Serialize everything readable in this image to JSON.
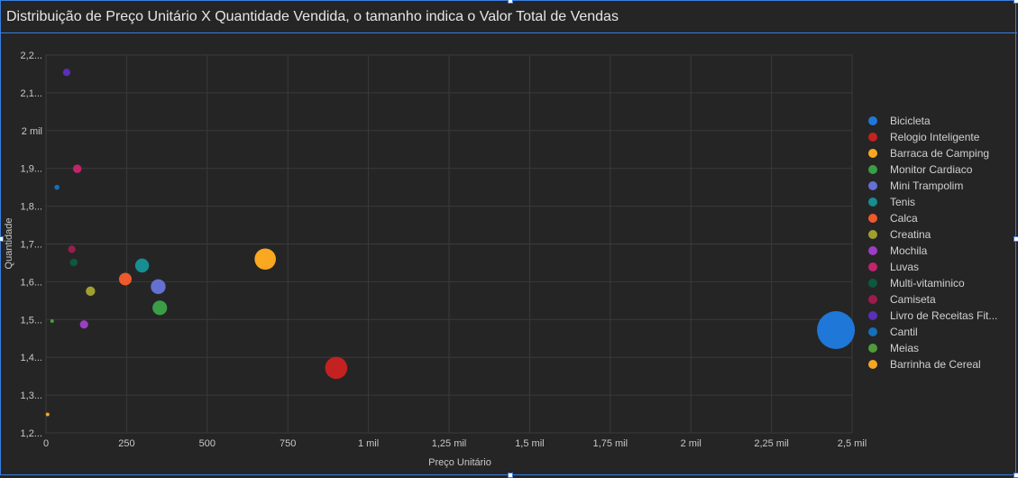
{
  "title": "Distribuição de Preço Unitário X Quantidade Vendida, o tamanho indica o Valor Total de Vendas",
  "chart_data": {
    "type": "scatter",
    "title": "Distribuição de Preço Unitário X Quantidade Vendida, o tamanho indica o Valor Total de Vendas",
    "xlabel": "Preço Unitário",
    "ylabel": "Quantidade",
    "xlim": [
      0,
      2500
    ],
    "ylim": [
      1200,
      2200
    ],
    "x_ticks": [
      0,
      250,
      500,
      750,
      1000,
      1250,
      1500,
      1750,
      2000,
      2250,
      2500
    ],
    "x_tick_labels": [
      "0",
      "250",
      "500",
      "750",
      "1 mil",
      "1,25 mil",
      "1,5 mil",
      "1,75 mil",
      "2 mil",
      "2,25 mil",
      "2,5 mil"
    ],
    "y_ticks": [
      1200,
      1300,
      1400,
      1500,
      1600,
      1700,
      1800,
      1900,
      2000,
      2100,
      2200
    ],
    "y_tick_labels": [
      "1,2...",
      "1,3...",
      "1,4...",
      "1,5...",
      "1,6...",
      "1,7...",
      "1,8...",
      "1,9...",
      "2 mil",
      "2,1...",
      "2,2..."
    ],
    "grid": true,
    "legend_position": "right",
    "series": [
      {
        "name": "Bicicleta",
        "x": 2450,
        "y": 1472,
        "size": 3606,
        "color": "#1f78d8"
      },
      {
        "name": "Relogio Inteligente",
        "x": 900,
        "y": 1372,
        "size": 1235,
        "color": "#c42121"
      },
      {
        "name": "Barraca de Camping",
        "x": 680,
        "y": 1660,
        "size": 1129,
        "color": "#f9a81f"
      },
      {
        "name": "Monitor Cardiaco",
        "x": 353,
        "y": 1531,
        "size": 540,
        "color": "#3a9e47"
      },
      {
        "name": "Mini Trampolim",
        "x": 348,
        "y": 1587,
        "size": 552,
        "color": "#6470d2"
      },
      {
        "name": "Tenis",
        "x": 298,
        "y": 1643,
        "size": 490,
        "color": "#168e92"
      },
      {
        "name": "Calca",
        "x": 246,
        "y": 1607,
        "size": 395,
        "color": "#ee5a2b"
      },
      {
        "name": "Creatina",
        "x": 138,
        "y": 1575,
        "size": 217,
        "color": "#a2a02d"
      },
      {
        "name": "Mochila",
        "x": 118,
        "y": 1487,
        "size": 175,
        "color": "#9a3ec3"
      },
      {
        "name": "Luvas",
        "x": 97,
        "y": 1899,
        "size": 184,
        "color": "#c0246b"
      },
      {
        "name": "Multi-vitaminico",
        "x": 86,
        "y": 1651,
        "size": 142,
        "color": "#0c5a3d"
      },
      {
        "name": "Camiseta",
        "x": 80,
        "y": 1686,
        "size": 135,
        "color": "#9c1b4d"
      },
      {
        "name": "Livro de Receitas Fit...",
        "x": 64,
        "y": 2154,
        "size": 138,
        "color": "#5b2fb6"
      },
      {
        "name": "Cantil",
        "x": 34,
        "y": 1850,
        "size": 63,
        "color": "#1470b8"
      },
      {
        "name": "Meias",
        "x": 19,
        "y": 1496,
        "size": 28,
        "color": "#4f9b3a"
      },
      {
        "name": "Barrinha de Cereal",
        "x": 5,
        "y": 1249,
        "size": 6,
        "color": "#f6a623"
      }
    ]
  }
}
